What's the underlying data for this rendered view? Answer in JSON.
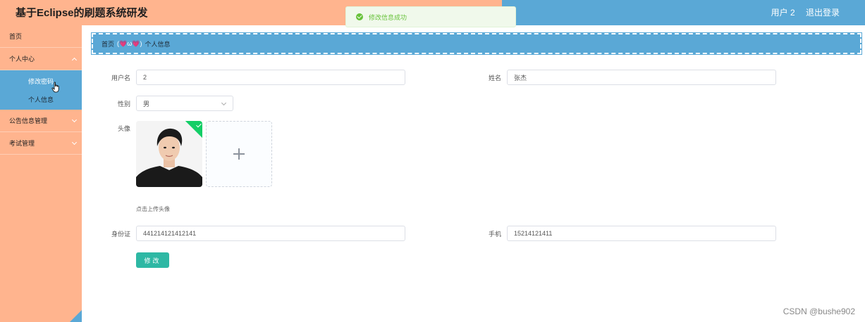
{
  "header": {
    "app_title": "基于Eclipse的刷题系统研发",
    "user_label": "用户 2",
    "logout_label": "退出登录"
  },
  "toast": {
    "message": "修改信息成功",
    "icon": "success-check-icon"
  },
  "sidebar": {
    "items": [
      {
        "label": "首页"
      },
      {
        "label": "个人中心",
        "expanded": true,
        "children": [
          {
            "label": "修改密码",
            "active": true
          },
          {
            "label": "个人信息"
          }
        ]
      },
      {
        "label": "公告信息管理"
      },
      {
        "label": "考试管理"
      }
    ]
  },
  "breadcrumb": {
    "home": "首页",
    "separator": "(💗ω💗)",
    "current": "个人信息"
  },
  "form": {
    "username_label": "用户名",
    "username_value": "2",
    "name_label": "姓名",
    "name_value": "张杰",
    "gender_label": "性别",
    "gender_value": "男",
    "avatar_label": "头像",
    "upload_tip": "点击上传头像",
    "idcard_label": "身份证",
    "idcard_value": "441214121412141",
    "phone_label": "手机",
    "phone_value": "15214121411",
    "submit_label": "修改"
  },
  "watermark": "CSDN @bushe902",
  "colors": {
    "sidebar_bg": "#ffb48e",
    "accent_blue": "#5aa8d6",
    "submit_button": "#2eb8a4",
    "toast_green": "#67c23a"
  }
}
